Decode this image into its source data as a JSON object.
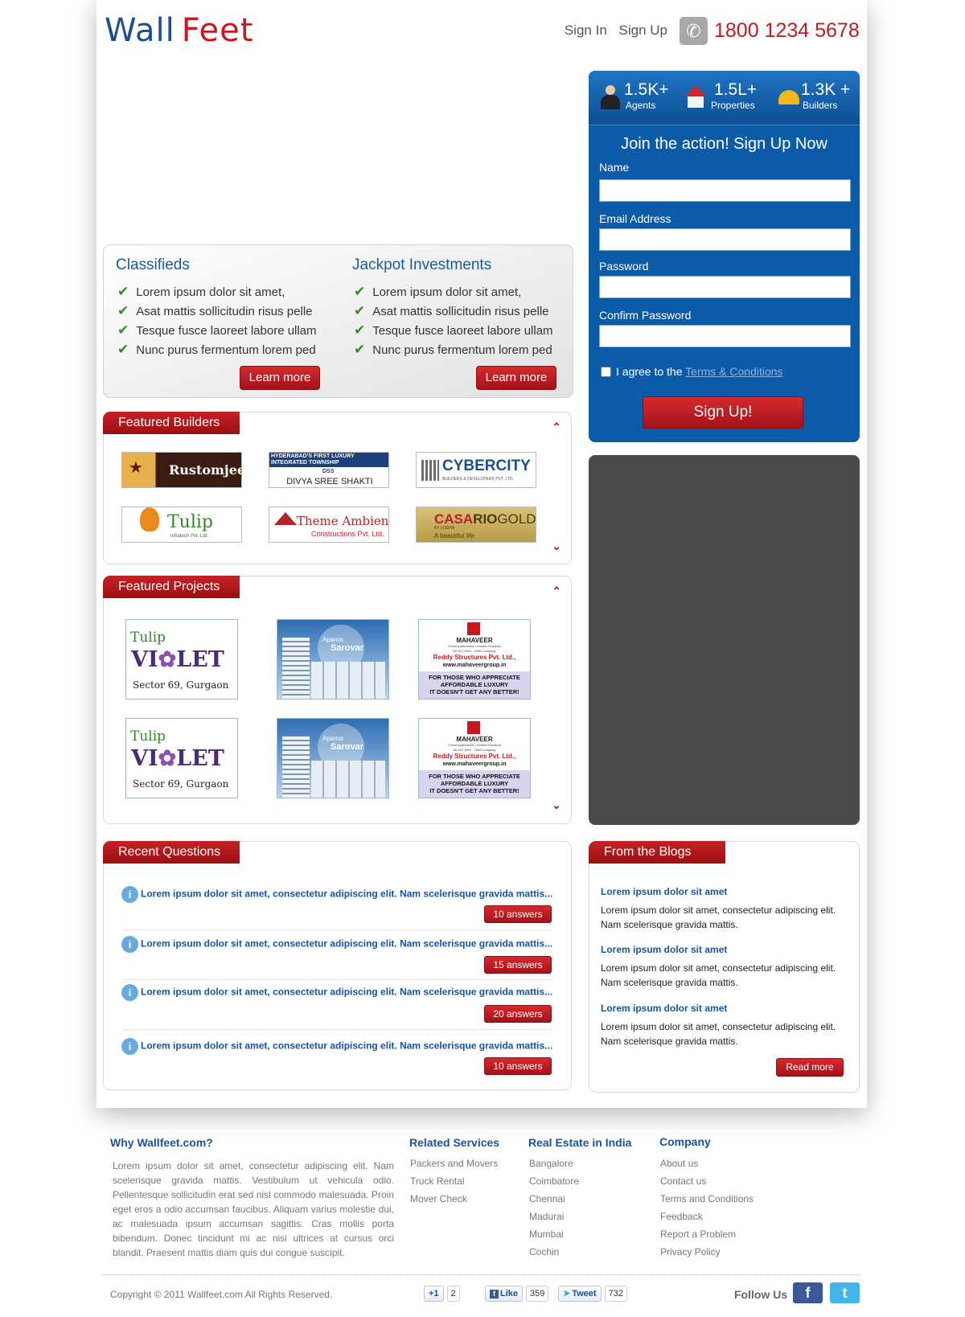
{
  "header": {
    "logo_part1": "Wall",
    "logo_part2": "Feet",
    "sign_in": "Sign In",
    "sign_up": "Sign Up",
    "phone": "1800 1234 5678"
  },
  "classifieds": {
    "title": "Classifieds",
    "items": [
      "Lorem ipsum dolor sit amet,",
      "Asat mattis sollicitudin risus pelle",
      "Tesque fusce laoreet labore ullam",
      "Nunc purus fermentum lorem ped"
    ],
    "button": "Learn more"
  },
  "jackpot": {
    "title": "Jackpot Investments",
    "items": [
      "Lorem ipsum dolor sit amet,",
      "Asat mattis sollicitudin risus pelle",
      "Tesque fusce laoreet labore ullam",
      "Nunc purus fermentum lorem ped"
    ],
    "button": "Learn more"
  },
  "featured_builders": {
    "title": "Featured Builders",
    "logos": [
      {
        "name": "Rustomjee"
      },
      {
        "line1": "HYDERABAD'S FIRST LUXURY",
        "line2": "INTEGRATED TOWNSHIP",
        "badge": "DSS",
        "name": "DIVYA SREE SHAKTI"
      },
      {
        "name": "CYBERCITY",
        "tagline": "BUILDERS & DEVELOPERS PVT. LTD."
      },
      {
        "name": "Tulip",
        "tagline": "Infratech Pvt. Ltd."
      },
      {
        "name": "Theme Ambience",
        "tagline": "Constructions Pvt. Ltd."
      },
      {
        "name_a": "CASA",
        "name_b": "RIO",
        "name_c": "GOLD",
        "by": "BY LODHA",
        "tagline": "A beautiful life"
      }
    ]
  },
  "featured_projects": {
    "title": "Featured Projects",
    "tulip": {
      "brand": "Tulip",
      "name_a": "VI",
      "name_b": "LET",
      "location": "Sector 69, Gurgaon"
    },
    "aparna": {
      "brand": "Aparna",
      "name": "Sarovar"
    },
    "mahaveer": {
      "brand": "MAHAVEER",
      "tagline": "Finest Apartments | Honest Practices",
      "iso": "An ISO 9001 : 2008 Company",
      "company": "Reddy Structures Pvt. Ltd.,",
      "url": "www.mahaveergroup.in",
      "slogan1": "FOR THOSE WHO APPRECIATE",
      "slogan2": "AFFORDABLE LUXURY",
      "slogan3": "IT DOESN'T GET ANY BETTER!"
    }
  },
  "stats": {
    "agents": {
      "value": "1.5K",
      "plus": "+",
      "label": "Agents"
    },
    "properties": {
      "value": "1.5L",
      "plus": "+",
      "label": "Properties"
    },
    "builders": {
      "value": "1.3K",
      "plus": "+",
      "label": "Builders"
    }
  },
  "signup_form": {
    "heading": "Join the action! Sign Up Now",
    "name_label": "Name",
    "email_label": "Email Address",
    "password_label": "Password",
    "confirm_label": "Confirm Password",
    "agree_text": "I agree to the",
    "terms_link": "Terms & Conditions",
    "submit": "Sign Up!"
  },
  "recent_questions": {
    "title": "Recent Questions",
    "items": [
      {
        "text": "Lorem ipsum dolor sit amet, consectetur adipiscing elit. Nam scelerisque gravida mattis...",
        "answers": "10 answers"
      },
      {
        "text": "Lorem ipsum dolor sit amet, consectetur adipiscing elit. Nam scelerisque gravida mattis...",
        "answers": "15 answers"
      },
      {
        "text": "Lorem ipsum dolor sit amet, consectetur adipiscing elit. Nam scelerisque gravida mattis...",
        "answers": "20 answers"
      },
      {
        "text": "Lorem ipsum dolor sit amet, consectetur adipiscing elit. Nam scelerisque gravida mattis...",
        "answers": "10 answers"
      }
    ]
  },
  "blogs": {
    "title": "From the Blogs",
    "items": [
      {
        "title": "Lorem ipsum dolor sit amet",
        "body": "Lorem ipsum dolor sit amet, consectetur adipiscing elit. Nam scelerisque gravida mattis."
      },
      {
        "title": "Lorem ipsum dolor sit amet",
        "body": "Lorem ipsum dolor sit amet, consectetur adipiscing elit. Nam scelerisque gravida mattis."
      },
      {
        "title": "Lorem ipsum dolor sit amet",
        "body": "Lorem ipsum dolor sit amet, consectetur adipiscing elit. Nam scelerisque gravida mattis."
      }
    ],
    "read_more": "Read more"
  },
  "footer": {
    "why_title": "Why Wallfeet.com?",
    "why_text": "Lorem ipsum dolor sit amet, consectetur adipiscing elit. Nam scelerisque gravida mattis. Vestibulum ut vehicula odio. Pellentesque sollicitudin erat sed nisl commodo malesuada. Proin eget eros a odio accumsan faucibus. Aliquam varius molestie dui, ac malesuada ipsum accumsan sagittis. Cras mollis porta bibendum. Donec tincidunt mi ac nisi ultrices at cursus orci blandit. Praesent mattis diam quis dui congue suscipit.",
    "related_title": "Related Services",
    "related": [
      "Packers and Movers",
      "Truck Rental",
      "Mover Check"
    ],
    "realestate_title": "Real Estate in India",
    "cities": [
      "Bangalore",
      "Coimbatore",
      "Chennai",
      "Madurai",
      "Mumbai",
      "Cochin"
    ],
    "company_title": "Company",
    "company": [
      "About us",
      "Contact us",
      "Terms and Conditions",
      "Feedback",
      "Report a Problem",
      "Privacy Policy"
    ],
    "copyright": "Copyright © 2011 Wallfeet.com All Rights Reserved.",
    "gplus_label": "+1",
    "gplus_count": "2",
    "like_label": "Like",
    "like_count": "359",
    "tweet_label": "Tweet",
    "tweet_count": "732",
    "follow_us": "Follow Us",
    "facebook_glyph": "f",
    "twitter_glyph": "t"
  },
  "colors": {
    "brand_blue": "#1d4d94",
    "brand_red": "#c8181e",
    "panel_blue": "#0c5ba8"
  }
}
